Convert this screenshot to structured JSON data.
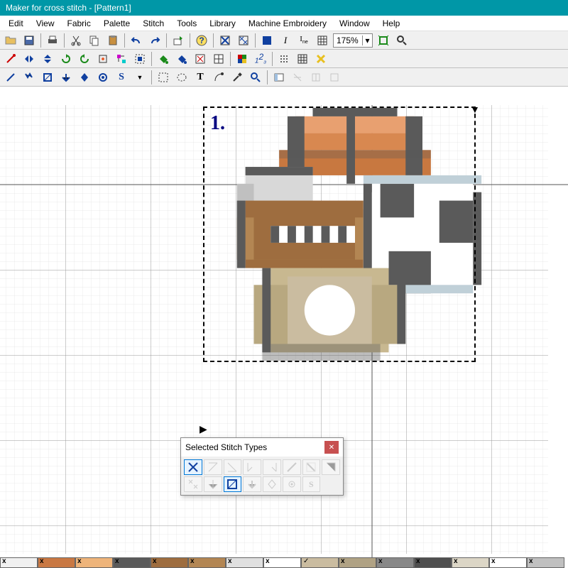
{
  "window": {
    "title": "Maker for cross stitch - [Pattern1]"
  },
  "menubar": [
    "Edit",
    "View",
    "Fabric",
    "Palette",
    "Stitch",
    "Tools",
    "Library",
    "Machine Embroidery",
    "Window",
    "Help"
  ],
  "toolbar": {
    "zoom": "175%"
  },
  "canvas": {
    "stitch_number": "1."
  },
  "floating_panel": {
    "title": "Selected Stitch Types"
  },
  "palette_colors": [
    {
      "c": "#f0f0f0",
      "m": "x"
    },
    {
      "c": "#c97843",
      "m": "x"
    },
    {
      "c": "#eeb47a",
      "m": "x"
    },
    {
      "c": "#5a5a5a",
      "m": "x"
    },
    {
      "c": "#9e6d3f",
      "m": "x"
    },
    {
      "c": "#b38653",
      "m": "x"
    },
    {
      "c": "#e0e0e0",
      "m": "x"
    },
    {
      "c": "#ffffff",
      "m": "x"
    },
    {
      "c": "#cabca0",
      "m": "chk"
    },
    {
      "c": "#b0a284",
      "m": "x"
    },
    {
      "c": "#888888",
      "m": "x"
    },
    {
      "c": "#4f4f4f",
      "m": "x"
    },
    {
      "c": "#dcd6c6",
      "m": "x"
    },
    {
      "c": "#ffffff",
      "m": "x"
    },
    {
      "c": "#c0c0c0",
      "m": "x"
    }
  ]
}
